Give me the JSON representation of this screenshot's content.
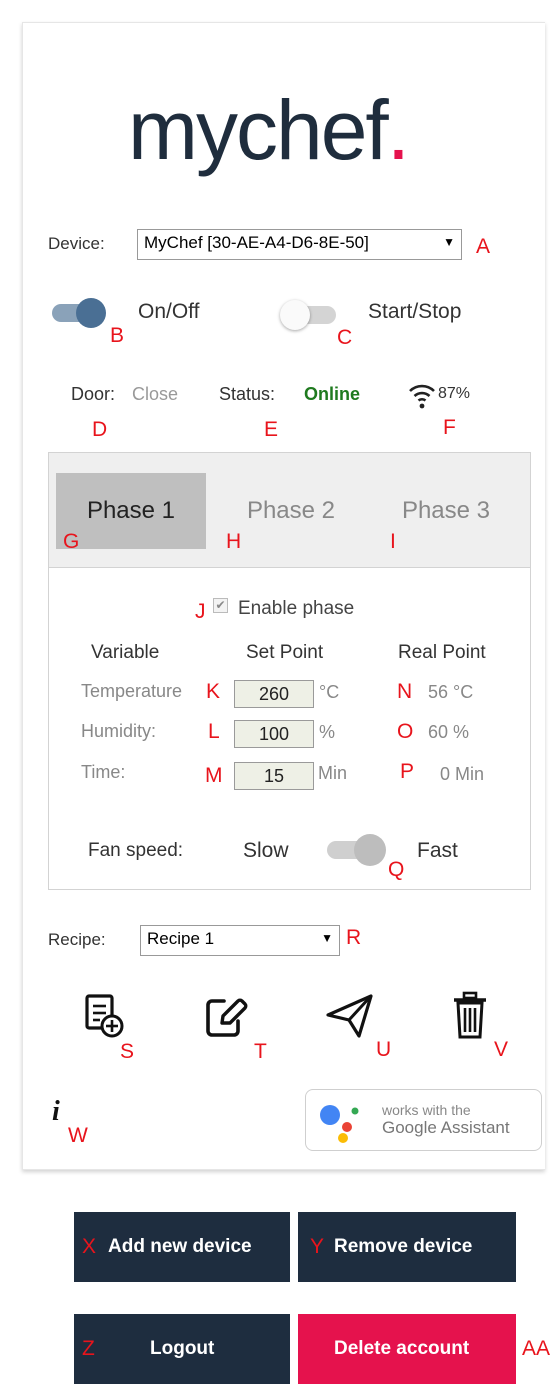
{
  "brand": {
    "name": "mychef",
    "dot": "."
  },
  "device": {
    "label": "Device:",
    "selected": "MyChef [30-AE-A4-D6-8E-50]",
    "marker": "A"
  },
  "toggles": {
    "power": {
      "label": "On/Off",
      "state": "on",
      "marker": "B"
    },
    "run": {
      "label": "Start/Stop",
      "state": "off",
      "marker": "C"
    }
  },
  "status": {
    "door_label": "Door:",
    "door_value": "Close",
    "door_marker": "D",
    "status_label": "Status:",
    "status_value": "Online",
    "status_marker": "E",
    "wifi_value": "87%",
    "wifi_marker": "F"
  },
  "phases": {
    "tabs": [
      {
        "label": "Phase 1",
        "marker": "G",
        "active": true
      },
      {
        "label": "Phase 2",
        "marker": "H",
        "active": false
      },
      {
        "label": "Phase 3",
        "marker": "I",
        "active": false
      }
    ],
    "enable": {
      "label": "Enable phase",
      "checked": true,
      "marker": "J"
    },
    "headers": {
      "variable": "Variable",
      "set_point": "Set Point",
      "real_point": "Real Point"
    },
    "rows": [
      {
        "name": "Temperature",
        "set_marker": "K",
        "set_value": "260",
        "unit": "°C",
        "real_marker": "N",
        "real_value": "56 °C"
      },
      {
        "name": "Humidity:",
        "set_marker": "L",
        "set_value": "100",
        "unit": "%",
        "real_marker": "O",
        "real_value": "60 %"
      },
      {
        "name": "Time:",
        "set_marker": "M",
        "set_value": "15",
        "unit": "Min",
        "real_marker": "P",
        "real_value": "0 Min"
      }
    ],
    "fan": {
      "label": "Fan speed:",
      "slow": "Slow",
      "fast": "Fast",
      "state": "fast",
      "marker": "Q"
    }
  },
  "recipe": {
    "label": "Recipe:",
    "selected": "Recipe 1",
    "marker": "R"
  },
  "actions": [
    {
      "icon": "add-recipe-icon",
      "marker": "S"
    },
    {
      "icon": "edit-icon",
      "marker": "T"
    },
    {
      "icon": "send-icon",
      "marker": "U"
    },
    {
      "icon": "trash-icon",
      "marker": "V"
    }
  ],
  "info": {
    "icon": "info-icon",
    "marker": "W"
  },
  "assistant": {
    "line1": "works with the",
    "line2": "Google Assistant"
  },
  "buttons": {
    "add_device": {
      "label": "Add new device",
      "marker": "X"
    },
    "remove_device": {
      "label": "Remove device",
      "marker": "Y"
    },
    "logout": {
      "label": "Logout",
      "marker": "Z"
    },
    "delete_account": {
      "label": "Delete account",
      "marker": "AA"
    }
  },
  "colors": {
    "brand_dark": "#1e2d3f",
    "brand_pink": "#e5124d",
    "online_green": "#1f7a1f",
    "toggle_on": "#4a6f94",
    "marker_red": "#e8141c"
  }
}
